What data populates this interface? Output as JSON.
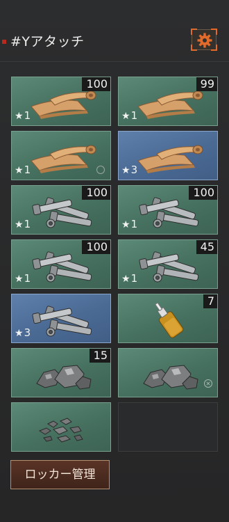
{
  "header": {
    "title": "#Yアタッチ",
    "settings_icon": "gear-icon",
    "accent": "#e26a2a"
  },
  "slots": [
    {
      "item": "scroll",
      "count": "100",
      "stars": "1",
      "bg": "green"
    },
    {
      "item": "scroll",
      "count": "99",
      "stars": "1",
      "bg": "green"
    },
    {
      "item": "scroll",
      "count": "",
      "stars": "1",
      "bg": "green",
      "badge": "circle-icon"
    },
    {
      "item": "scroll",
      "count": "",
      "stars": "3",
      "bg": "blue"
    },
    {
      "item": "bolts",
      "count": "100",
      "stars": "1",
      "bg": "green"
    },
    {
      "item": "bolts",
      "count": "100",
      "stars": "1",
      "bg": "green"
    },
    {
      "item": "bolts",
      "count": "100",
      "stars": "1",
      "bg": "green"
    },
    {
      "item": "bolts",
      "count": "45",
      "stars": "1",
      "bg": "green"
    },
    {
      "item": "bolts",
      "count": "",
      "stars": "3",
      "bg": "blue"
    },
    {
      "item": "oil-bottle",
      "count": "7",
      "stars": "",
      "bg": "green"
    },
    {
      "item": "ore",
      "count": "15",
      "stars": "",
      "bg": "green"
    },
    {
      "item": "ore",
      "count": "",
      "stars": "",
      "bg": "green",
      "badge": "circle-x-icon"
    },
    {
      "item": "stones",
      "count": "",
      "stars": "",
      "bg": "green"
    },
    {
      "item": "empty",
      "count": "",
      "stars": "",
      "bg": "empty"
    }
  ],
  "star_glyph": "★",
  "footer": {
    "locker_button_label": "ロッカー管理"
  }
}
